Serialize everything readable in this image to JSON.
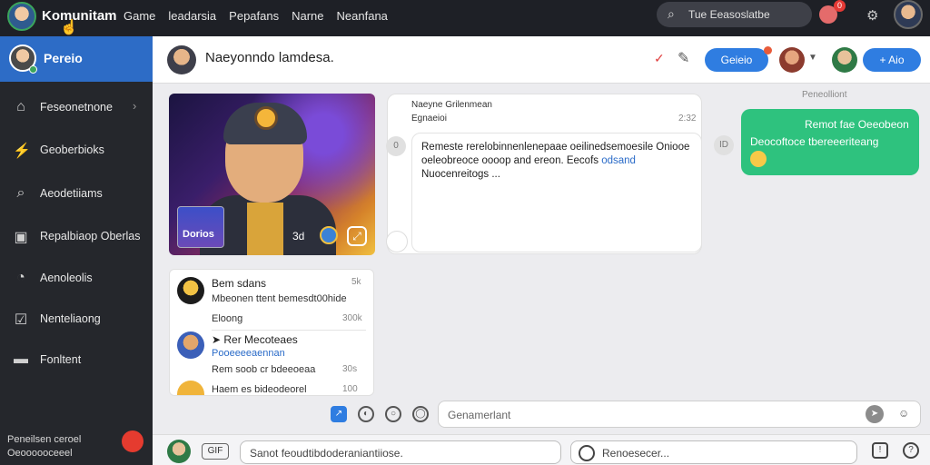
{
  "topbar": {
    "brand": "Komunitam",
    "nav": [
      "Game",
      "leadarsia",
      "Pepafans",
      "Narne",
      "Neanfana"
    ],
    "search_placeholder": "Tue Eeasoslatbe",
    "notif_count": "0"
  },
  "sidebar": {
    "profile_name": "Pereio",
    "items": [
      {
        "label": "Feseonetnone",
        "icon": "home-icon"
      },
      {
        "label": "Geoberbioks",
        "icon": "bolt-icon"
      },
      {
        "label": "Aeodetiiams",
        "icon": "search-icon"
      },
      {
        "label": "Repalbiaop Oberlas",
        "icon": "image-icon"
      },
      {
        "label": "Aenoleolis",
        "icon": "clock-icon"
      },
      {
        "label": "Nenteliaong",
        "icon": "checkbox-icon"
      },
      {
        "label": "Fonltent",
        "icon": "folder-icon"
      }
    ],
    "footer_line1": "Peneilsen ceroel",
    "footer_line2": "Oeoooooceeel"
  },
  "chat_header": {
    "title": "Naeyonndo lamdesa.",
    "pill_label": "Geieio",
    "add_label": "Aio"
  },
  "image_card": {
    "tag": "Dorios",
    "ctrl_label": "3d"
  },
  "message_card": {
    "sender": "Naeyne Grilenmean",
    "subtitle": "Egnaeioi",
    "time": "2:32",
    "body": "Remeste rerelobinnenlenepaae oeilinedsemoesile Oniooe oeleobreoce oooop and ereon. Eecofs",
    "link": "odsand",
    "body2": "Nuocenreitogs ...",
    "badge": "0"
  },
  "reply": {
    "read_label": "Peneolliont",
    "line1": "Remot fae Oeeobeon",
    "line2": "Deocoftoce tbereeeriteang",
    "badge": "ID"
  },
  "comments": [
    {
      "name": "Bem sdans",
      "time": "5k",
      "text": "Mbeonen ttent bemesdt00hide",
      "sub": "Eloong",
      "sub_time": "300k"
    },
    {
      "name": "Rer Mecoteaes",
      "time": "",
      "text": "Pooeeeeaennan",
      "sub": "Rem soob cr bdeeoeaa",
      "sub_time": "30s"
    },
    {
      "name": "",
      "time": "",
      "text": "Haem es bideodeorel",
      "sub": "",
      "sub_time": "100"
    }
  ],
  "comment_input": {
    "placeholder": "Genamerlant"
  },
  "bottom": {
    "gif_label": "GIF",
    "input1": "Sanot feoudtibdoderaniantiiose.",
    "input2": "Renoesecer..."
  }
}
